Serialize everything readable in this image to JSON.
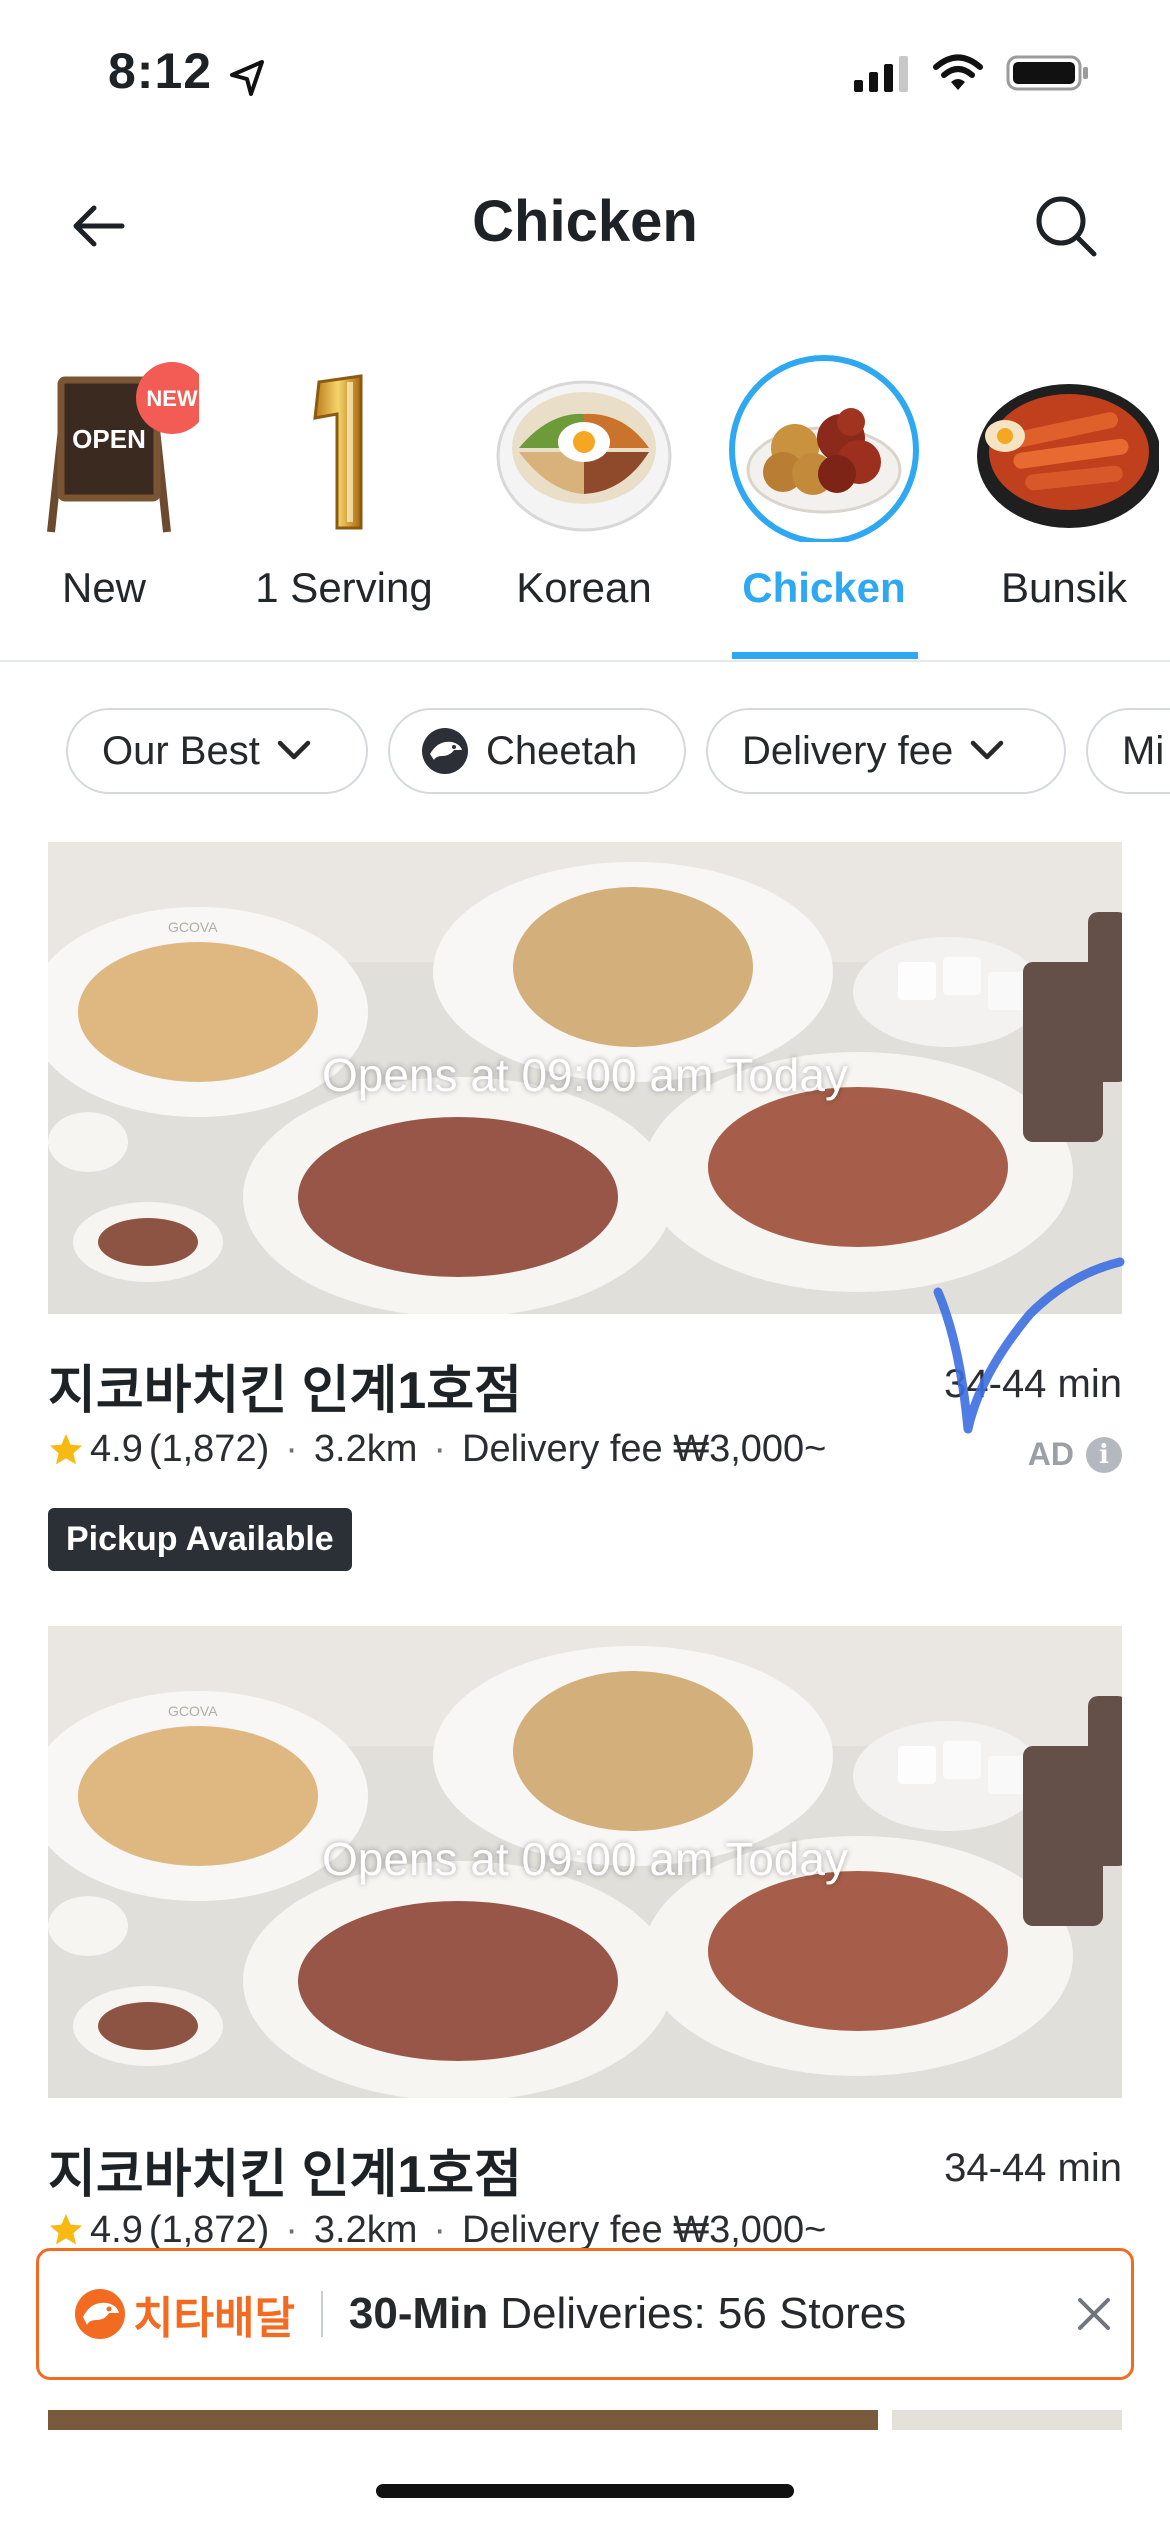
{
  "status_bar": {
    "time": "8:12"
  },
  "header": {
    "title": "Chicken"
  },
  "categories": [
    {
      "label": "New",
      "badge": "NEW",
      "sign_text": "OPEN"
    },
    {
      "label": "1 Serving"
    },
    {
      "label": "Korean"
    },
    {
      "label": "Chicken",
      "selected": true
    },
    {
      "label": "Bunsik"
    }
  ],
  "filters": [
    {
      "label": "Our Best"
    },
    {
      "label": "Cheetah"
    },
    {
      "label": "Delivery fee"
    },
    {
      "label": "Mi"
    }
  ],
  "stores": [
    {
      "name": "지코바치킨 인계1호점",
      "opens": "Opens at 09:00 am Today",
      "eta": "34-44 min",
      "rating": "4.9",
      "reviews": "(1,872)",
      "distance": "3.2km",
      "delivery_fee": "Delivery fee ₩3,000~",
      "ad_label": "AD",
      "badge": "Pickup Available",
      "brand_print": "GCOVA"
    },
    {
      "name": "지코바치킨 인계1호점",
      "opens": "Opens at 09:00 am Today",
      "eta": "34-44 min",
      "rating": "4.9",
      "reviews": "(1,872)",
      "distance": "3.2km",
      "delivery_fee": "Delivery fee ₩3,000~",
      "brand_print": "GCOVA"
    }
  ],
  "banner": {
    "brand": "치타배달",
    "strong": "30-Min",
    "rest": "Deliveries: 56 Stores"
  },
  "colors": {
    "accent": "#2ea8f0",
    "cheetah_orange": "#f36b21",
    "star": "#f8b913"
  }
}
